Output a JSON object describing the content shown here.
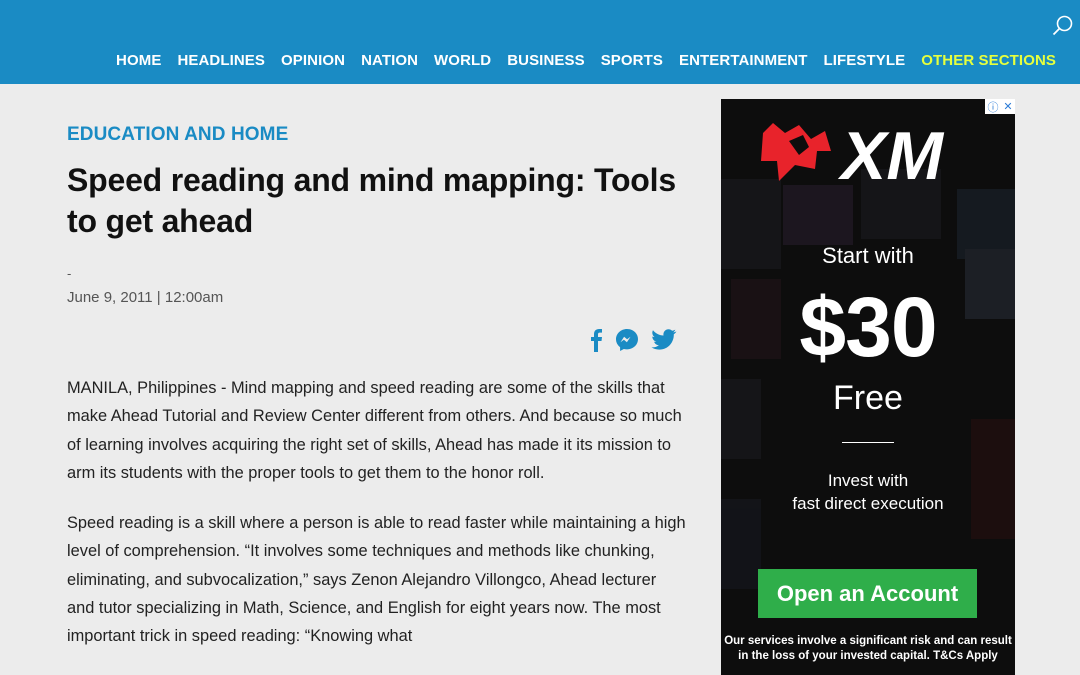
{
  "nav": {
    "items": [
      "HOME",
      "HEADLINES",
      "OPINION",
      "NATION",
      "WORLD",
      "BUSINESS",
      "SPORTS",
      "ENTERTAINMENT",
      "LIFESTYLE"
    ],
    "other_sections": "OTHER SECTIONS",
    "accent_color": "#e6ff3d",
    "bar_color": "#1a8bc4"
  },
  "article": {
    "section": "EDUCATION AND HOME",
    "headline": "Speed reading and mind mapping: Tools to get ahead",
    "author": "-",
    "date": "June 9, 2011 | 12:00am",
    "share_icons": [
      "facebook-icon",
      "messenger-icon",
      "twitter-icon"
    ],
    "paragraphs": [
      "MANILA, Philippines -  Mind mapping and speed reading are some of the skills that make Ahead Tutorial and Review Center different from others. And because so much of learning involves acquiring the right set of skills, Ahead has made it its mission to arm its students with the proper tools to get them to the honor roll.",
      "Speed reading is a skill where a person is able to read faster while maintaining a high level of comprehension. “It involves some techniques and methods like chunking, eliminating, and subvocalization,” says Zenon Alejandro Villongco, Ahead lecturer and tutor specializing in Math, Science, and English for eight years now. The most important trick in speed reading: “Knowing what"
    ]
  },
  "ad": {
    "brand": "XM",
    "start": "Start with",
    "amount": "$30",
    "free": "Free",
    "invest_line1": "Invest with",
    "invest_line2": "fast direct execution",
    "cta": "Open an Account",
    "disclaimer_line1": "Our services involve a significant risk and can result",
    "disclaimer_line2": "in the loss of your invested capital. T&Cs Apply",
    "cta_color": "#2fae4a",
    "brand_red": "#e8232b"
  }
}
